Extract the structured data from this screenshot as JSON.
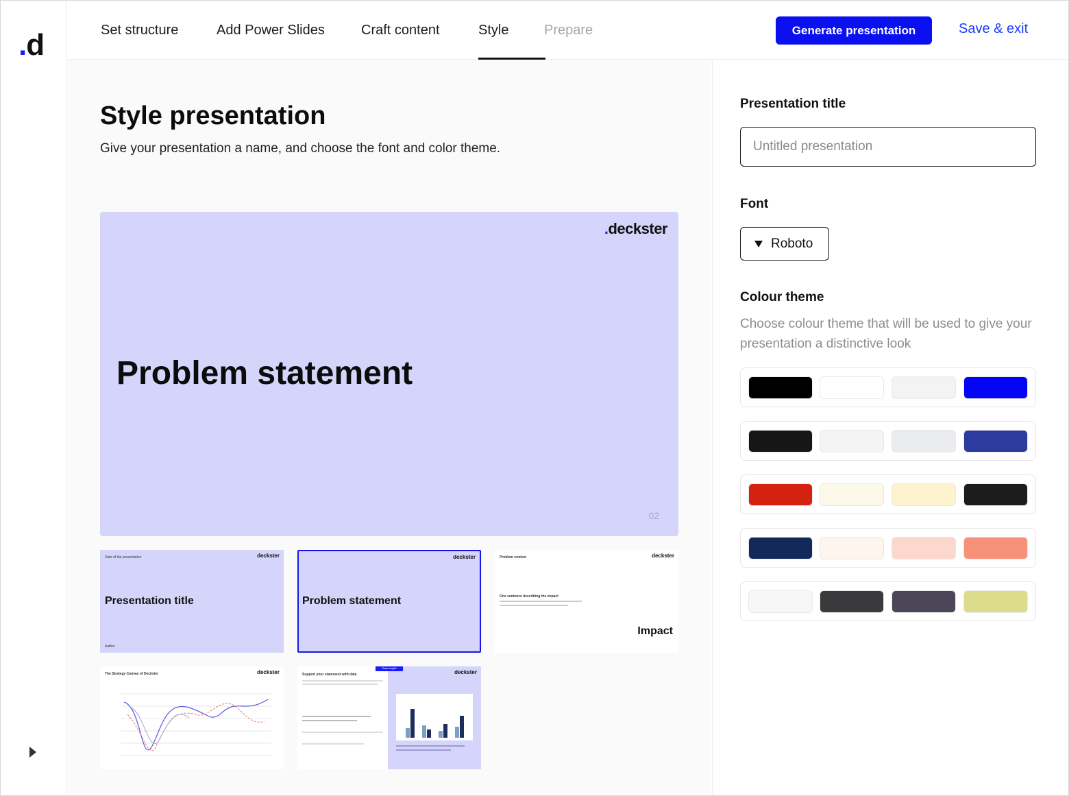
{
  "app": {
    "logo_text": "d"
  },
  "nav": {
    "steps": [
      {
        "label": "Set structure"
      },
      {
        "label": "Add Power Slides"
      },
      {
        "label": "Craft content"
      },
      {
        "label": "Style"
      },
      {
        "label": "Prepare"
      }
    ],
    "active_step": "Style",
    "generate_label": "Generate presentation",
    "save_exit_label": "Save & exit"
  },
  "main": {
    "title": "Style presentation",
    "subtitle": "Give your presentation a name, and choose the font and color theme.",
    "hero": {
      "brand": "deckster",
      "title": "Problem statement",
      "number": "02"
    },
    "thumbnails": [
      {
        "brand": "deckster",
        "title": "Presentation title",
        "small": "Date of the presentation",
        "footer": "Author"
      },
      {
        "brand": "deckster",
        "title": "Problem statement",
        "selected": true
      },
      {
        "brand": "deckster",
        "heading": "Problem context",
        "small": "One sentence describing the impact",
        "title": "Impact"
      },
      {
        "brand": "deckster",
        "heading": "The Strategy Canvas of Deckster"
      },
      {
        "brand": "deckster",
        "heading": "Support your statement with data",
        "tag": "Data insight"
      }
    ]
  },
  "panel": {
    "title_label": "Presentation title",
    "title_placeholder": "Untitled presentation",
    "font_label": "Font",
    "font_value": "Roboto",
    "theme_label": "Colour theme",
    "theme_desc": "Choose colour theme that will be used to give your presentation a distinctive look",
    "themes": [
      [
        "#000000",
        "#ffffff",
        "#f3f3f4",
        "#0505f5"
      ],
      [
        "#161616",
        "#f4f4f5",
        "#ebecef",
        "#2d3a9e"
      ],
      [
        "#d42210",
        "#fcf8ea",
        "#fdf4cf",
        "#1c1c1c"
      ],
      [
        "#13295a",
        "#fdf5ee",
        "#fcd8cc",
        "#f8917a"
      ],
      [
        "#f7f7f7",
        "#3a3a3d",
        "#4c4658",
        "#dcdc8c"
      ]
    ]
  }
}
